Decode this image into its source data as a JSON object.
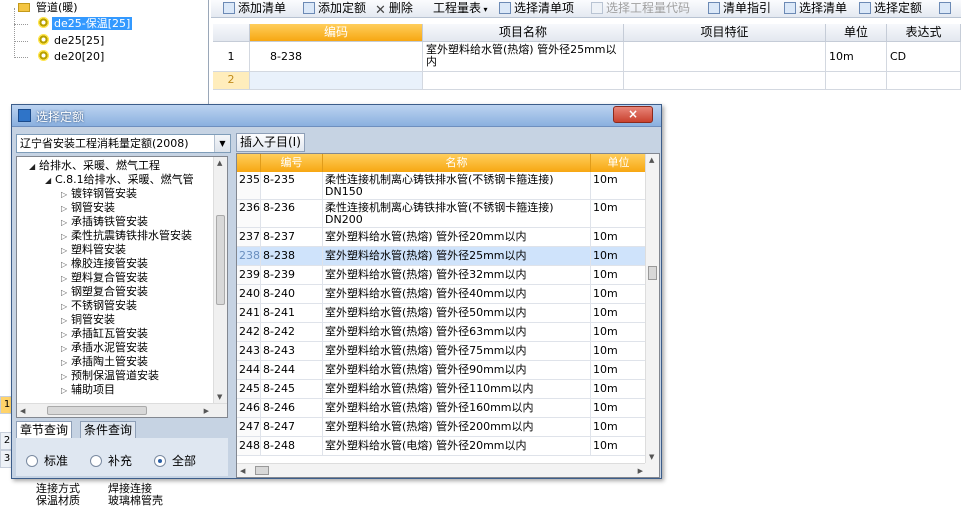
{
  "left_tree": {
    "items": [
      {
        "label": "管道(暖)"
      },
      {
        "label": "de25-保温[25]"
      },
      {
        "label": "de25[25]"
      },
      {
        "label": "de20[20]"
      }
    ]
  },
  "background_left": {
    "row_numbers": [
      "1",
      "2",
      "3"
    ],
    "cells": [
      "连接方式",
      "焊接连接",
      "保温材质",
      "玻璃棉管壳"
    ]
  },
  "toolbar": {
    "add_bill": "添加清单",
    "add_quota": "添加定额",
    "delete": "删除",
    "quantity_table": "工程量表",
    "select_bill_item": "选择清单项",
    "select_quantity_code": "选择工程量代码",
    "bill_guide": "清单指引",
    "select_bill": "选择清单",
    "select_quota": "选择定额"
  },
  "bill_grid": {
    "columns": [
      "编码",
      "项目名称",
      "项目特征",
      "单位",
      "表达式"
    ],
    "rows": [
      {
        "num": "1",
        "code": "8-238",
        "name": "室外塑料给水管(热熔) 管外径25mm以内",
        "feature": "",
        "unit": "10m",
        "expr": "CD"
      },
      {
        "num": "2",
        "code": "",
        "name": "",
        "feature": "",
        "unit": "",
        "expr": ""
      }
    ]
  },
  "dialog": {
    "title": "选择定额",
    "close": "×",
    "quota_library": "辽宁省安装工程消耗量定额(2008)",
    "insert_child": "插入子目(I)",
    "tree": [
      {
        "label": "给排水、采暖、燃气工程",
        "level": 0
      },
      {
        "label": "C.8.1给排水、采暖、燃气管",
        "level": 1
      },
      {
        "label": "镀锌钢管安装",
        "level": 2
      },
      {
        "label": "钢管安装",
        "level": 2
      },
      {
        "label": "承插铸铁管安装",
        "level": 2
      },
      {
        "label": "柔性抗震铸铁排水管安装",
        "level": 2
      },
      {
        "label": "塑料管安装",
        "level": 2
      },
      {
        "label": "橡胶连接管安装",
        "level": 2
      },
      {
        "label": "塑料复合管安装",
        "level": 2
      },
      {
        "label": "钢塑复合管安装",
        "level": 2
      },
      {
        "label": "不锈钢管安装",
        "level": 2
      },
      {
        "label": "铜管安装",
        "level": 2
      },
      {
        "label": "承插缸瓦管安装",
        "level": 2
      },
      {
        "label": "承插水泥管安装",
        "level": 2
      },
      {
        "label": "承插陶土管安装",
        "level": 2
      },
      {
        "label": "预制保温管道安装",
        "level": 2
      },
      {
        "label": "辅助项目",
        "level": 2
      }
    ],
    "tabs": [
      "章节查询",
      "条件查询"
    ],
    "radios": [
      {
        "label": "标准",
        "checked": false
      },
      {
        "label": "补充",
        "checked": false
      },
      {
        "label": "全部",
        "checked": true
      }
    ],
    "list_columns": [
      "编号",
      "名称",
      "单位"
    ],
    "list_rows": [
      {
        "num": "235",
        "code": "8-235",
        "name": "柔性连接机制离心铸铁排水管(不锈钢卡箍连接) DN150",
        "unit": "10m"
      },
      {
        "num": "236",
        "code": "8-236",
        "name": "柔性连接机制离心铸铁排水管(不锈钢卡箍连接) DN200",
        "unit": "10m"
      },
      {
        "num": "237",
        "code": "8-237",
        "name": "室外塑料给水管(热熔) 管外径20mm以内",
        "unit": "10m"
      },
      {
        "num": "238",
        "code": "8-238",
        "name": "室外塑料给水管(热熔) 管外径25mm以内",
        "unit": "10m",
        "selected": true
      },
      {
        "num": "239",
        "code": "8-239",
        "name": "室外塑料给水管(热熔) 管外径32mm以内",
        "unit": "10m"
      },
      {
        "num": "240",
        "code": "8-240",
        "name": "室外塑料给水管(热熔) 管外径40mm以内",
        "unit": "10m"
      },
      {
        "num": "241",
        "code": "8-241",
        "name": "室外塑料给水管(热熔) 管外径50mm以内",
        "unit": "10m"
      },
      {
        "num": "242",
        "code": "8-242",
        "name": "室外塑料给水管(热熔) 管外径63mm以内",
        "unit": "10m"
      },
      {
        "num": "243",
        "code": "8-243",
        "name": "室外塑料给水管(热熔) 管外径75mm以内",
        "unit": "10m"
      },
      {
        "num": "244",
        "code": "8-244",
        "name": "室外塑料给水管(热熔) 管外径90mm以内",
        "unit": "10m"
      },
      {
        "num": "245",
        "code": "8-245",
        "name": "室外塑料给水管(热熔) 管外径110mm以内",
        "unit": "10m"
      },
      {
        "num": "246",
        "code": "8-246",
        "name": "室外塑料给水管(热熔) 管外径160mm以内",
        "unit": "10m"
      },
      {
        "num": "247",
        "code": "8-247",
        "name": "室外塑料给水管(热熔) 管外径200mm以内",
        "unit": "10m"
      },
      {
        "num": "248",
        "code": "8-248",
        "name": "室外塑料给水管(电熔) 管外径20mm以内",
        "unit": "10m"
      }
    ]
  },
  "colors": {
    "header_accent": "#f7a712",
    "selection": "#cfe3fb",
    "title_bar": "#8ab0df"
  }
}
